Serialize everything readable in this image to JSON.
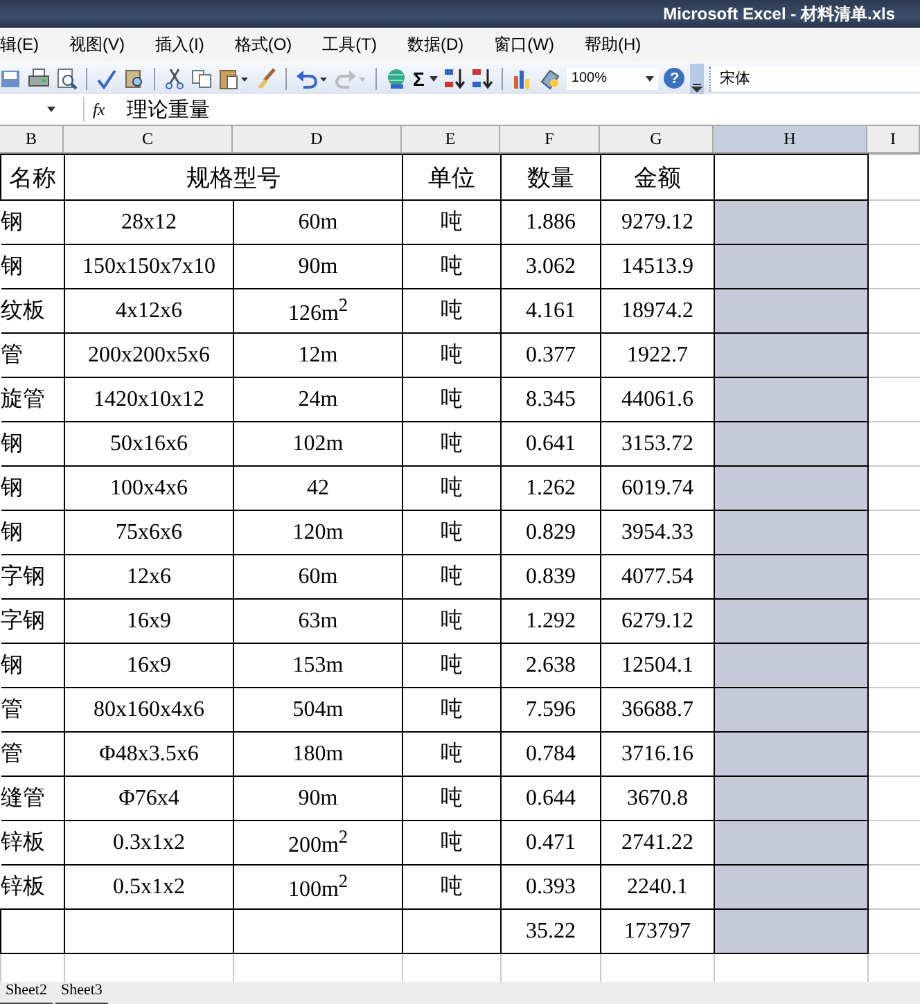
{
  "window": {
    "title": "Microsoft Excel - 材料清单.xls"
  },
  "menu": [
    {
      "label": "辑(E)"
    },
    {
      "label": "视图(V)"
    },
    {
      "label": "插入(I)"
    },
    {
      "label": "格式(O)"
    },
    {
      "label": "工具(T)"
    },
    {
      "label": "数据(D)"
    },
    {
      "label": "窗口(W)"
    },
    {
      "label": "帮助(H)"
    }
  ],
  "toolbar": {
    "sum_glyph": "Σ",
    "zoom": "100%",
    "help_glyph": "?",
    "font": "宋体"
  },
  "formula_bar": {
    "fx": "fx",
    "content": "理论重量"
  },
  "columns": [
    {
      "label": "B",
      "selected": false
    },
    {
      "label": "C",
      "selected": false
    },
    {
      "label": "D",
      "selected": false
    },
    {
      "label": "E",
      "selected": false
    },
    {
      "label": "F",
      "selected": false
    },
    {
      "label": "G",
      "selected": false
    },
    {
      "label": "H",
      "selected": true
    },
    {
      "label": "I",
      "selected": false
    }
  ],
  "header": {
    "name": "名称",
    "spec": "规格型号",
    "unit": "单位",
    "qty": "数量",
    "amount": "金额"
  },
  "rows": [
    {
      "name": "钢",
      "spec": "28x12",
      "length": "60m",
      "unit": "吨",
      "qty": "1.886",
      "amount": "9279.12"
    },
    {
      "name": "钢",
      "spec": "150x150x7x10",
      "length": "90m",
      "unit": "吨",
      "qty": "3.062",
      "amount": "14513.9"
    },
    {
      "name": "纹板",
      "spec": "4x12x6",
      "length": "126m$^{2}$",
      "unit": "吨",
      "qty": "4.161",
      "amount": "18974.2"
    },
    {
      "name": "管",
      "spec": "200x200x5x6",
      "length": "12m",
      "unit": "吨",
      "qty": "0.377",
      "amount": "1922.7"
    },
    {
      "name": "旋管",
      "spec": "1420x10x12",
      "length": "24m",
      "unit": "吨",
      "qty": "8.345",
      "amount": "44061.6"
    },
    {
      "name": "钢",
      "spec": "50x16x6",
      "length": "102m",
      "unit": "吨",
      "qty": "0.641",
      "amount": "3153.72"
    },
    {
      "name": "钢",
      "spec": "100x4x6",
      "length": "42",
      "unit": "吨",
      "qty": "1.262",
      "amount": "6019.74"
    },
    {
      "name": "钢",
      "spec": "75x6x6",
      "length": "120m",
      "unit": "吨",
      "qty": "0.829",
      "amount": "3954.33"
    },
    {
      "name": "字钢",
      "spec": "12x6",
      "length": "60m",
      "unit": "吨",
      "qty": "0.839",
      "amount": "4077.54"
    },
    {
      "name": "字钢",
      "spec": "16x9",
      "length": "63m",
      "unit": "吨",
      "qty": "1.292",
      "amount": "6279.12"
    },
    {
      "name": "钢",
      "spec": "16x9",
      "length": "153m",
      "unit": "吨",
      "qty": "2.638",
      "amount": "12504.1"
    },
    {
      "name": "管",
      "spec": "80x160x4x6",
      "length": "504m",
      "unit": "吨",
      "qty": "7.596",
      "amount": "36688.7"
    },
    {
      "name": "管",
      "spec": "Φ48x3.5x6",
      "length": "180m",
      "unit": "吨",
      "qty": "0.784",
      "amount": "3716.16"
    },
    {
      "name": "缝管",
      "spec": "Φ76x4",
      "length": "90m",
      "unit": "吨",
      "qty": "0.644",
      "amount": "3670.8"
    },
    {
      "name": "锌板",
      "spec": "0.3x1x2",
      "length": "200m$^{2}$",
      "unit": "吨",
      "qty": "0.471",
      "amount": "2741.22"
    },
    {
      "name": "锌板",
      "spec": "0.5x1x2",
      "length": "100m$^{2}$",
      "unit": "吨",
      "qty": "0.393",
      "amount": "2240.1"
    }
  ],
  "totals": {
    "qty": "35.22",
    "amount": "173797"
  },
  "sheet_tabs": [
    {
      "label": "Sheet2",
      "selected": false
    },
    {
      "label": "Sheet3",
      "selected": false
    }
  ]
}
